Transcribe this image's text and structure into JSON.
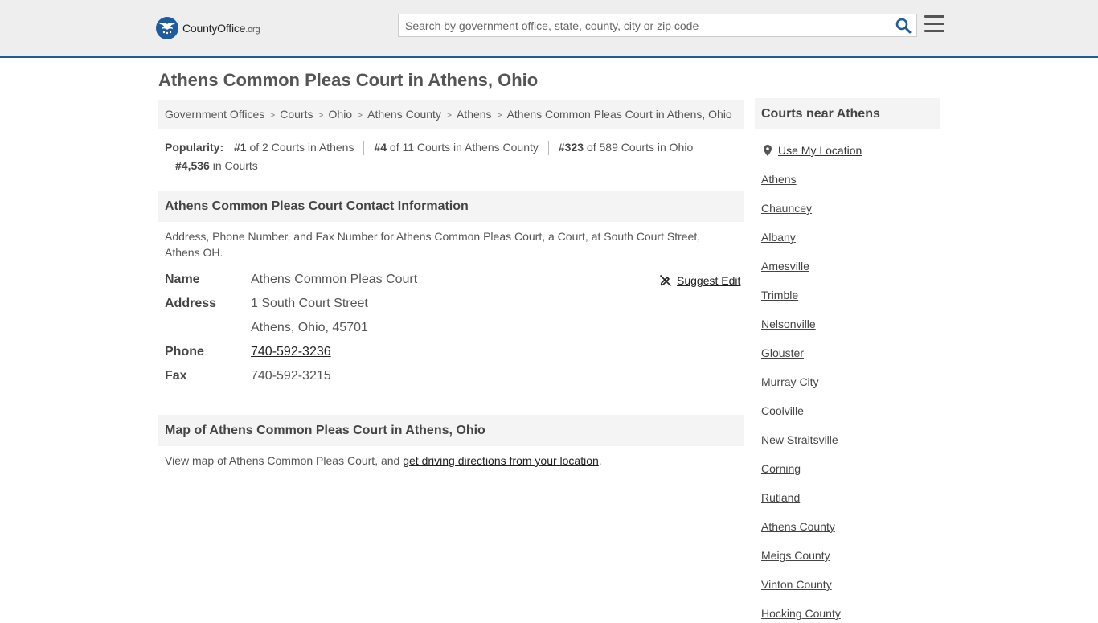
{
  "header": {
    "logo_main": "CountyOffice",
    "logo_suffix": ".org",
    "search_placeholder": "Search by government office, state, county, city or zip code"
  },
  "page_title": "Athens Common Pleas Court in Athens, Ohio",
  "breadcrumb": [
    "Government Offices",
    "Courts",
    "Ohio",
    "Athens County",
    "Athens",
    "Athens Common Pleas Court in Athens, Ohio"
  ],
  "popularity": {
    "label": "Popularity:",
    "items": [
      {
        "rank": "#1",
        "text": "of 2 Courts in Athens"
      },
      {
        "rank": "#4",
        "text": "of 11 Courts in Athens County"
      },
      {
        "rank": "#323",
        "text": "of 589 Courts in Ohio"
      },
      {
        "rank": "#4,536",
        "text": "in Courts"
      }
    ]
  },
  "contact": {
    "heading": "Athens Common Pleas Court Contact Information",
    "description": "Address, Phone Number, and Fax Number for Athens Common Pleas Court, a Court, at South Court Street, Athens OH.",
    "suggest_edit": "Suggest Edit",
    "name_label": "Name",
    "name_value": "Athens Common Pleas Court",
    "address_label": "Address",
    "address_line1": "1 South Court Street",
    "address_line2": "Athens, Ohio, 45701",
    "phone_label": "Phone",
    "phone_value": "740-592-3236",
    "fax_label": "Fax",
    "fax_value": "740-592-3215"
  },
  "map": {
    "heading": "Map of Athens Common Pleas Court in Athens, Ohio",
    "text_before": "View map of Athens Common Pleas Court, and ",
    "link_text": "get driving directions from your location",
    "text_after": "."
  },
  "sidebar": {
    "heading": "Courts near Athens",
    "use_location": "Use My Location",
    "items": [
      "Athens",
      "Chauncey",
      "Albany",
      "Amesville",
      "Trimble",
      "Nelsonville",
      "Glouster",
      "Murray City",
      "Coolville",
      "New Straitsville",
      "Corning",
      "Rutland",
      "Athens County",
      "Meigs County",
      "Vinton County",
      "Hocking County"
    ]
  },
  "colors": {
    "brand_blue": "#1f5b9d",
    "header_bg": "#eeeeee",
    "panel_bg": "#f4f4f4"
  }
}
